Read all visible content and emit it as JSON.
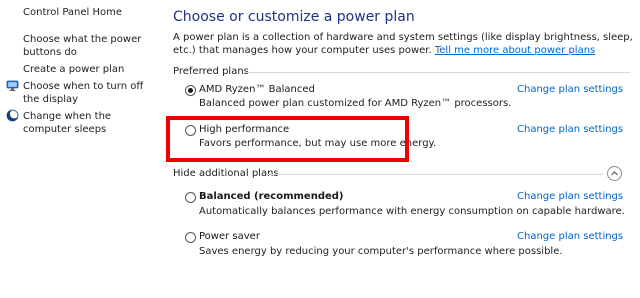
{
  "sidebar": {
    "items": [
      {
        "label": "Control Panel Home"
      },
      {
        "label": "Choose what the power buttons do"
      },
      {
        "label": "Create a power plan"
      },
      {
        "label": "Choose when to turn off the display"
      },
      {
        "label": "Change when the computer sleeps"
      }
    ]
  },
  "main": {
    "title": "Choose or customize a power plan",
    "intro_text": "A power plan is a collection of hardware and system settings (like display brightness, sleep, etc.) that manages how your computer uses power. ",
    "intro_link": "Tell me more about power plans",
    "preferred_header": "Preferred plans",
    "additional_header": "Hide additional plans",
    "settings_link": "Change plan settings",
    "plans": [
      {
        "name": "AMD Ryzen™ Balanced",
        "desc": "Balanced power plan customized for AMD Ryzen™ processors.",
        "selected": true
      },
      {
        "name": "High performance",
        "desc": "Favors performance, but may use more energy.",
        "selected": false
      },
      {
        "name": "Balanced (recommended)",
        "desc": "Automatically balances performance with energy consumption on capable hardware.",
        "selected": false
      },
      {
        "name": "Power saver",
        "desc": "Saves energy by reducing your computer's performance where possible.",
        "selected": false
      }
    ]
  },
  "colors": {
    "title": "#1e3287",
    "link": "#0066cc",
    "highlight": "#ee0000"
  },
  "icons": {
    "display": "monitor-power-icon",
    "sleep": "moon-sleep-icon",
    "collapse": "chevron-up-icon"
  }
}
